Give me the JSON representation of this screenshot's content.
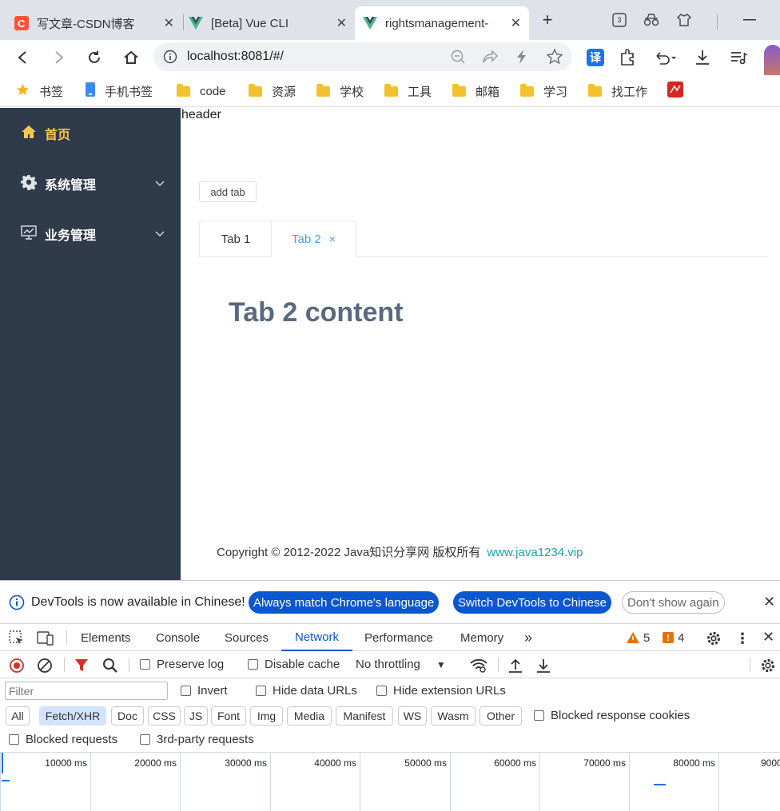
{
  "browser": {
    "tabs": [
      {
        "title": "写文章-CSDN博客"
      },
      {
        "title": "[Beta] Vue CLI"
      },
      {
        "title": "rightsmanagement-"
      }
    ],
    "tab_count_badge": "3",
    "url": "localhost:8081/#/",
    "bookmarks": [
      "书签",
      "手机书签",
      "code",
      "资源",
      "学校",
      "工具",
      "邮箱",
      "学习",
      "找工作"
    ],
    "translate_label": "译",
    "colors": {
      "csdn": "#fc5531",
      "vue": "#41b883",
      "accent": "#0b57d0"
    }
  },
  "app": {
    "header": "header",
    "sidebar": [
      {
        "label": "首页",
        "icon": "home-icon",
        "active": true
      },
      {
        "label": "系统管理",
        "icon": "gear-icon"
      },
      {
        "label": "业务管理",
        "icon": "monitor-icon"
      }
    ],
    "add_tab_label": "add tab",
    "tabs": [
      {
        "label": "Tab 1"
      },
      {
        "label": "Tab 2",
        "active": true,
        "close": "×"
      }
    ],
    "content": "Tab 2 content",
    "footer_text": "Copyright © 2012-2022 Java知识分享网 版权所有",
    "footer_link": "www.java1234.vip"
  },
  "devtools": {
    "banner_text": "DevTools is now available in Chinese!",
    "banner_buttons": [
      "Always match Chrome's language",
      "Switch DevTools to Chinese",
      "Don't show again"
    ],
    "tabs": [
      "Elements",
      "Console",
      "Sources",
      "Network",
      "Performance",
      "Memory"
    ],
    "active_tab": "Network",
    "warnings": "5",
    "issues": "4",
    "preserve_log": "Preserve log",
    "disable_cache": "Disable cache",
    "throttling": "No throttling",
    "filter_placeholder": "Filter",
    "invert": "Invert",
    "hide_data_urls": "Hide data URLs",
    "hide_extension_urls": "Hide extension URLs",
    "filter_types": [
      "All",
      "Fetch/XHR",
      "Doc",
      "CSS",
      "JS",
      "Font",
      "Img",
      "Media",
      "Manifest",
      "WS",
      "Wasm",
      "Other"
    ],
    "active_filter": "Fetch/XHR",
    "blocked_response_cookies": "Blocked response cookies",
    "blocked_requests": "Blocked requests",
    "third_party": "3rd-party requests",
    "timeline_ticks": [
      "10000 ms",
      "20000 ms",
      "30000 ms",
      "40000 ms",
      "50000 ms",
      "60000 ms",
      "70000 ms",
      "80000 ms",
      "9000"
    ]
  }
}
